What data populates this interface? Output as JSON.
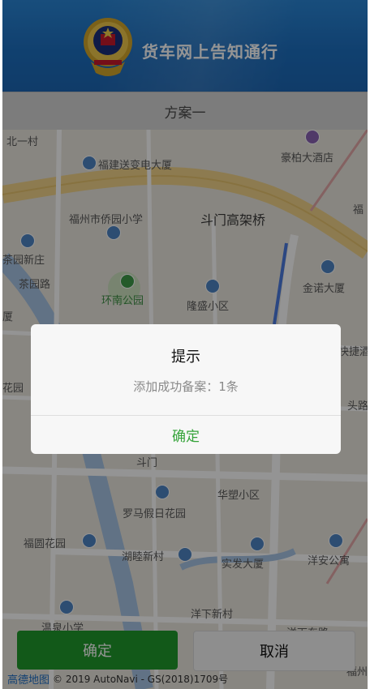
{
  "header": {
    "title": "货车网上告知通行"
  },
  "plan_bar": {
    "label": "方案一"
  },
  "map": {
    "pois": [
      "北一村",
      "福建送变电大厦",
      "豪柏大酒店",
      "福州市侨园小学",
      "斗门高架桥",
      "福",
      "茶园新庄",
      "茶园路",
      "金诺大厦",
      "环南公园",
      "隆盛小区",
      "厦",
      "快捷酒",
      "花园",
      "头路",
      "斗门",
      "华塑小区",
      "罗马假日花园",
      "福圆花园",
      "湖睦新村",
      "实发大厦",
      "洋安公寓",
      "洋下新村",
      "温泉小学",
      "洋下东路",
      "福州"
    ]
  },
  "dialog": {
    "title": "提示",
    "message": "添加成功备案：1条",
    "ok_label": "确定"
  },
  "actions": {
    "confirm_label": "确定",
    "cancel_label": "取消"
  },
  "footer": {
    "map_logo": "高德地图",
    "copyright": "© 2019 AutoNavi - GS(2018)1709号"
  },
  "colors": {
    "header_blue": "#1d6fc0",
    "confirm_green": "#1f9a2b",
    "dialog_ok": "#35a33a"
  }
}
